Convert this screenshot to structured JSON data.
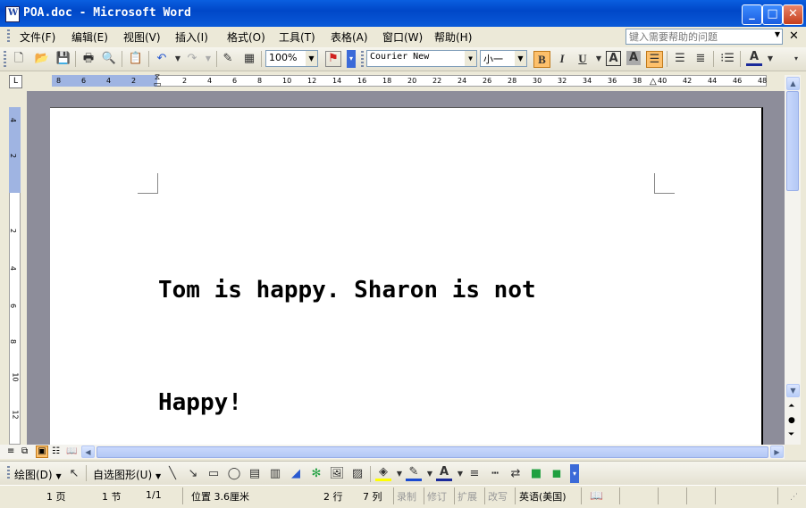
{
  "window": {
    "title": "POA.doc - Microsoft Word",
    "icon": "word-doc-icon",
    "icon_glyph": "W"
  },
  "menu": {
    "items": [
      "文件(F)",
      "编辑(E)",
      "视图(V)",
      "插入(I)",
      "格式(O)",
      "工具(T)",
      "表格(A)",
      "窗口(W)",
      "帮助(H)"
    ],
    "help_placeholder": "键入需要帮助的问题"
  },
  "toolbar": {
    "zoom": "100%",
    "font_name": "Courier New",
    "font_size": "小一",
    "bold": "B",
    "italic": "I",
    "underline": "U",
    "char_border": "A",
    "char_shading": "A",
    "font_color": "A"
  },
  "ruler": {
    "marks": [
      "8",
      "6",
      "4",
      "2",
      "2",
      "4",
      "6",
      "8",
      "10",
      "12",
      "14",
      "16",
      "18",
      "20",
      "22",
      "24",
      "26",
      "28",
      "30",
      "32",
      "34",
      "36",
      "38",
      "40",
      "42",
      "44",
      "46",
      "48"
    ],
    "vmarks": [
      "4",
      "2",
      "2",
      "4",
      "6",
      "8",
      "10",
      "12"
    ]
  },
  "document": {
    "lines": [
      "Tom is happy. Sharon is not",
      "Happy!"
    ]
  },
  "drawing_toolbar": {
    "draw_label": "绘图(D)",
    "autoshapes_label": "自选图形(U)"
  },
  "status": {
    "page": "1 页",
    "section": "1 节",
    "page_of": "1/1",
    "position": "位置 3.6厘米",
    "line": "2 行",
    "column": "7 列",
    "rec": "录制",
    "trk": "修订",
    "ext": "扩展",
    "ovr": "改写",
    "language": "英语(美国)"
  },
  "colors": {
    "titlebar": "#0a5fe0",
    "page": "#ffffff",
    "doc_background": "#8d8d9a",
    "active_button": "#fdc06b"
  }
}
